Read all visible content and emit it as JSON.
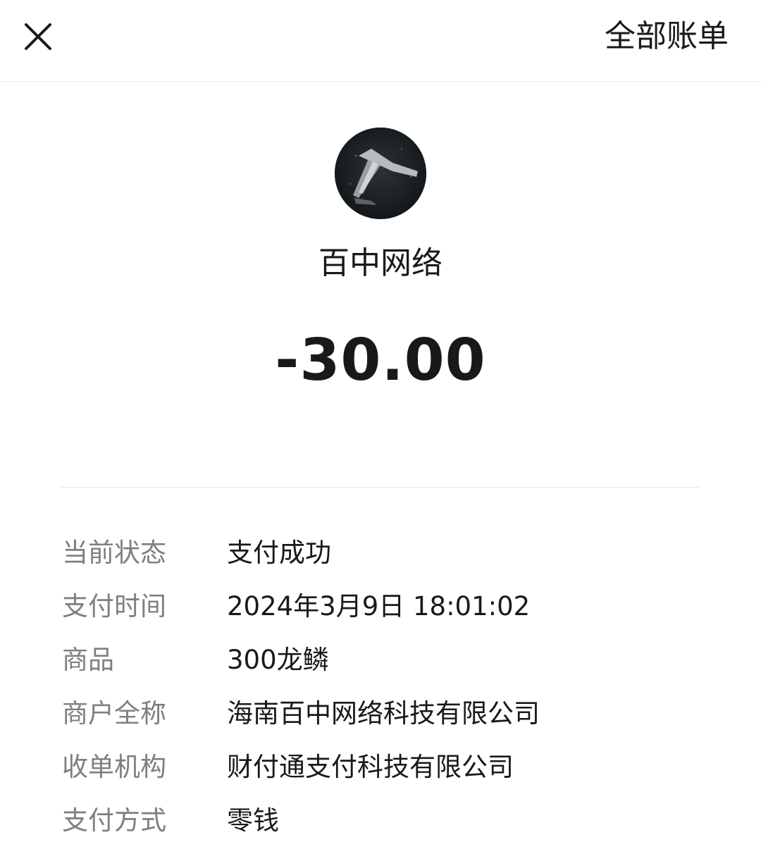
{
  "header": {
    "close_icon": "close-icon",
    "all_bills_label": "全部账单"
  },
  "merchant": {
    "avatar_icon": "merchant-avatar",
    "name": "百中网络"
  },
  "amount": "-30.00",
  "details": [
    {
      "label": "当前状态",
      "value": "支付成功"
    },
    {
      "label": "支付时间",
      "value": "2024年3月9日 18:01:02"
    },
    {
      "label": "商品",
      "value": "300龙鳞"
    },
    {
      "label": "商户全称",
      "value": "海南百中网络科技有限公司"
    },
    {
      "label": "收单机构",
      "value": "财付通支付科技有限公司"
    },
    {
      "label": "支付方式",
      "value": "零钱"
    }
  ],
  "colors": {
    "text_primary": "#191919",
    "text_secondary": "#7f7f7f",
    "divider": "#e6e6e6"
  }
}
